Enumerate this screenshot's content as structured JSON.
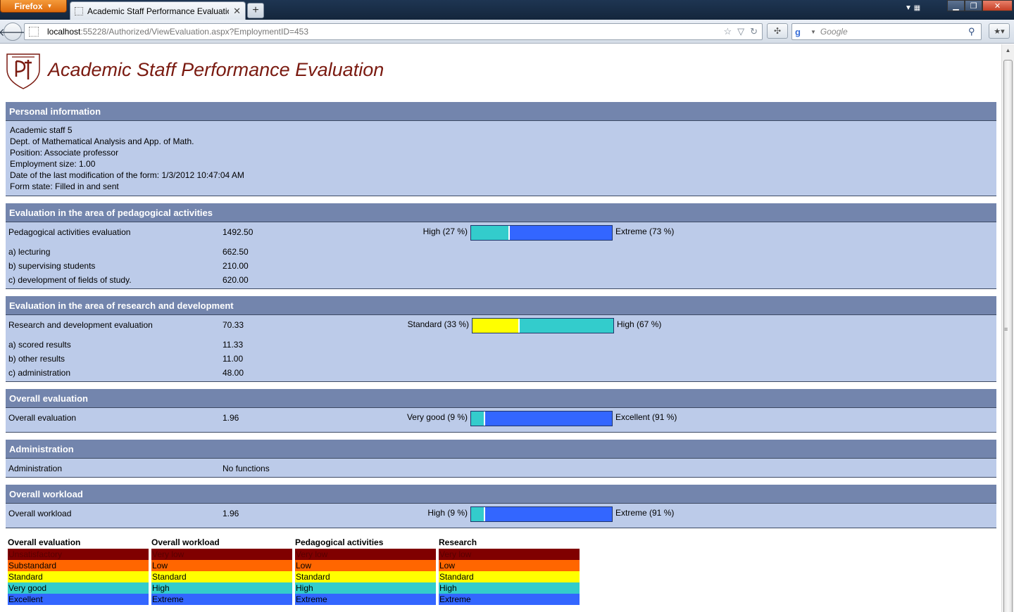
{
  "browser": {
    "menu_button": "Firefox",
    "tab_title": "Academic Staff Performance Evaluation ...",
    "new_tab_label": "+",
    "url_host": "localhost",
    "url_rest": ":55228/Authorized/ViewEvaluation.aspx?EmploymentID=453",
    "search_placeholder": "Google",
    "search_engine_icon": "g"
  },
  "page": {
    "title": "Academic Staff Performance Evaluation"
  },
  "personal": {
    "header": "Personal information",
    "lines": [
      "Academic staff 5",
      "Dept. of Mathematical Analysis and App. of Math.",
      "Position: Associate professor",
      "Employment size: 1.00",
      "Date of the last modification of the form: 1/3/2012 10:47:04 AM",
      "Form state: Filled in and sent"
    ]
  },
  "pedagogical": {
    "header": "Evaluation in the area of pedagogical activities",
    "main": {
      "label": "Pedagogical activities evaluation",
      "value": "1492.50",
      "left_label": "High (27 %)",
      "right_label": "Extreme (73 %)",
      "left_fraction": 0.27,
      "left_color": "#33cccc",
      "right_color": "#3366ff"
    },
    "sub": [
      {
        "label": "a) lecturing",
        "value": "662.50"
      },
      {
        "label": "b) supervising students",
        "value": "210.00"
      },
      {
        "label": "c) development of fields of study.",
        "value": "620.00"
      }
    ]
  },
  "research": {
    "header": "Evaluation in the area of research and development",
    "main": {
      "label": "Research and development evaluation",
      "value": "70.33",
      "left_label": "Standard (33 %)",
      "right_label": "High (67 %)",
      "left_fraction": 0.33,
      "left_color": "#ffff00",
      "right_color": "#33cccc"
    },
    "sub": [
      {
        "label": "a) scored results",
        "value": "11.33"
      },
      {
        "label": "b) other results",
        "value": "11.00"
      },
      {
        "label": "c) administration",
        "value": "48.00"
      }
    ]
  },
  "overall": {
    "header": "Overall evaluation",
    "main": {
      "label": "Overall evaluation",
      "value": "1.96",
      "left_label": "Very good (9 %)",
      "right_label": "Excellent (91 %)",
      "left_fraction": 0.09,
      "left_color": "#33cccc",
      "right_color": "#3366ff"
    }
  },
  "administration": {
    "header": "Administration",
    "label": "Administration",
    "value": "No functions"
  },
  "workload": {
    "header": "Overall workload",
    "main": {
      "label": "Overall workload",
      "value": "1.96",
      "left_label": "High (9 %)",
      "right_label": "Extreme (91 %)",
      "left_fraction": 0.09,
      "left_color": "#33cccc",
      "right_color": "#3366ff"
    }
  },
  "legend": {
    "colors": [
      "#800000",
      "#ff6600",
      "#ffff00",
      "#33cccc",
      "#3366ff"
    ],
    "columns": [
      {
        "title": "Overall evaluation",
        "items": [
          "Unsatisfactory",
          "Substandard",
          "Standard",
          "Very good",
          "Excellent"
        ]
      },
      {
        "title": "Overall workload",
        "items": [
          "Very low",
          "Low",
          "Standard",
          "High",
          "Extreme"
        ]
      },
      {
        "title": "Pedagogical activities",
        "items": [
          "Very low",
          "Low",
          "Standard",
          "High",
          "Extreme"
        ]
      },
      {
        "title": "Research",
        "items": [
          "Very low",
          "Low",
          "Standard",
          "High",
          "Extreme"
        ]
      }
    ]
  }
}
